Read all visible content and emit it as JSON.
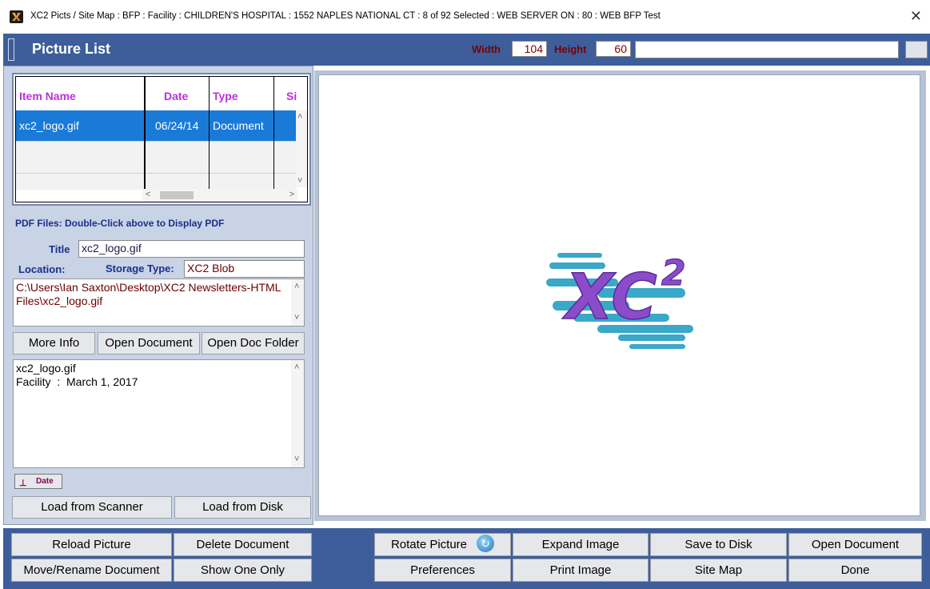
{
  "window": {
    "title": "XC2 Picts / Site Map :  BFP : Facility : CHILDREN'S HOSPITAL : 1552 NAPLES NATIONAL CT : 8 of 92 Selected : WEB SERVER ON : 80 : WEB BFP Test",
    "close_glyph": "✕"
  },
  "header": {
    "title": "Picture List",
    "width_label": "Width",
    "width_value": "104",
    "height_label": "Height",
    "height_value": "60"
  },
  "list": {
    "columns": [
      "Item Name",
      "Date",
      "Type",
      "Si"
    ],
    "rows": [
      {
        "name": "xc2_logo.gif",
        "date": "06/24/14",
        "type": "Document"
      }
    ]
  },
  "details": {
    "pdf_note": "PDF Files:  Double-Click above to Display PDF",
    "title_label": "Title",
    "title_value": "xc2_logo.gif",
    "location_label": "Location:",
    "storage_label": "Storage Type:",
    "storage_value": "XC2 Blob",
    "path": "C:\\Users\\Ian Saxton\\Desktop\\XC2 Newsletters-HTML Files\\xc2_logo.gif",
    "buttons": [
      "More Info",
      "Open Document",
      "Open Doc Folder"
    ],
    "notes_line1": "xc2_logo.gif",
    "notes_line2": "Facility  :  March 1, 2017",
    "date_button": "Date",
    "load_scanner": "Load from Scanner",
    "load_disk": "Load from Disk"
  },
  "picture": {
    "logo_text": "XC",
    "logo_sup": "2",
    "logo_color": "#8a4cc8",
    "stripe_color": "#3aa8c8"
  },
  "bottom_buttons": {
    "reload_picture": "Reload Picture",
    "delete_document": "Delete Document",
    "rotate_picture": "Rotate Picture",
    "expand_image": "Expand Image",
    "save_to_disk": "Save to Disk",
    "open_document": "Open Document",
    "move_rename": "Move/Rename Document",
    "show_one_only": "Show One Only",
    "preferences": "Preferences",
    "print_image": "Print Image",
    "site_map": "Site Map",
    "done": "Done"
  },
  "colors": {
    "header_bg": "#3d5e9b",
    "panel_bg": "#c9d3e6",
    "selection": "#1a7ad8",
    "column_header": "#b833d8",
    "label_blue": "#1a2f8a",
    "label_red": "#7a0000"
  }
}
